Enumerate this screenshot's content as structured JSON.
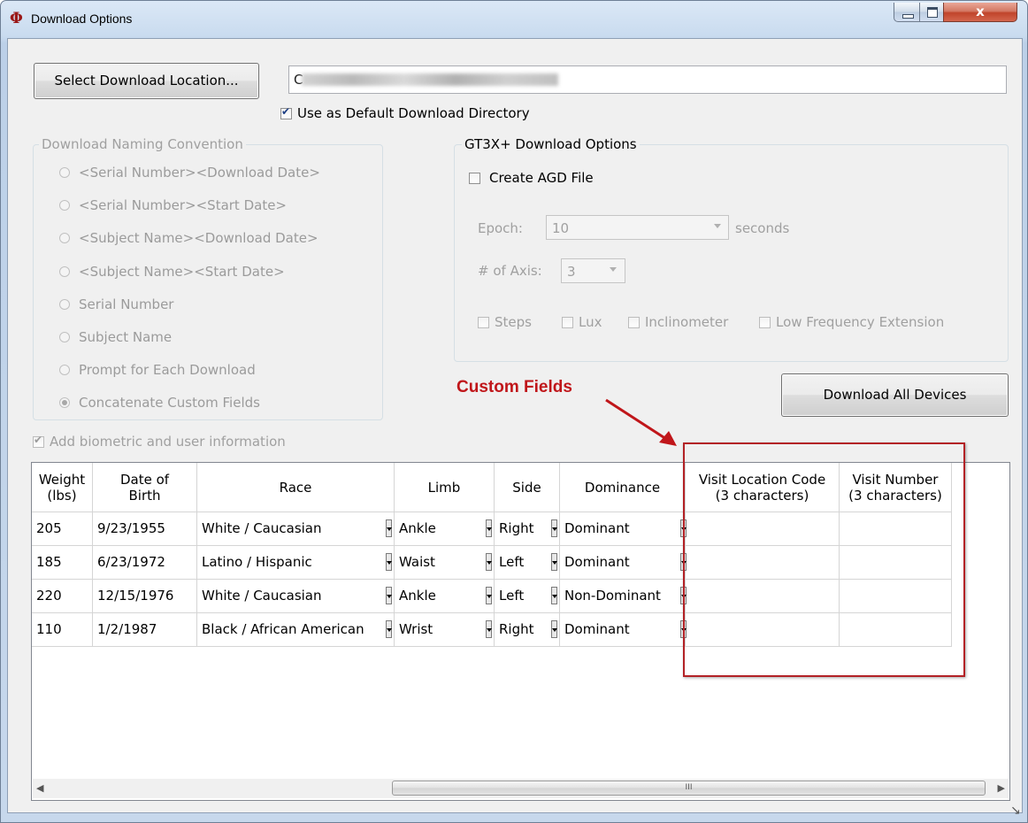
{
  "window": {
    "title": "Download Options",
    "close_glyph": "x"
  },
  "location": {
    "button_label": "Select Download Location...",
    "path_visible_prefix": "C",
    "use_default_label": "Use as Default Download Directory",
    "use_default_checked": true
  },
  "naming": {
    "legend": "Download Naming Convention",
    "options": [
      {
        "label": "<Serial Number><Download Date>",
        "selected": false
      },
      {
        "label": "<Serial Number><Start Date>",
        "selected": false
      },
      {
        "label": "<Subject Name><Download Date>",
        "selected": false
      },
      {
        "label": "<Subject Name><Start Date>",
        "selected": false
      },
      {
        "label": "Serial Number",
        "selected": false
      },
      {
        "label": "Subject Name",
        "selected": false
      },
      {
        "label": "Prompt for Each Download",
        "selected": false
      },
      {
        "label": "Concatenate Custom Fields",
        "selected": true
      }
    ]
  },
  "gt3x": {
    "legend": "GT3X+ Download Options",
    "create_agd_label": "Create AGD File",
    "create_agd_checked": false,
    "epoch_label": "Epoch:",
    "epoch_value": "10",
    "epoch_units": "seconds",
    "axis_label": "# of Axis:",
    "axis_value": "3",
    "options": [
      "Steps",
      "Lux",
      "Inclinometer",
      "Low Frequency Extension"
    ]
  },
  "callout": {
    "text": "Custom Fields",
    "color": "#c0161a"
  },
  "download_all_label": "Download All Devices",
  "biometric": {
    "label": "Add biometric and user information",
    "checked": true
  },
  "grid": {
    "headers": [
      [
        "Weight",
        "(lbs)"
      ],
      [
        "Date of",
        "Birth"
      ],
      [
        "Race"
      ],
      [
        "Limb"
      ],
      [
        "Side"
      ],
      [
        "Dominance"
      ],
      [
        "Visit Location Code",
        "(3 characters)"
      ],
      [
        "Visit Number",
        "(3 characters)"
      ]
    ],
    "rows": [
      [
        "205",
        "9/23/1955",
        "White / Caucasian",
        "Ankle",
        "Right",
        "Dominant",
        "",
        ""
      ],
      [
        "185",
        "6/23/1972",
        "Latino / Hispanic",
        "Waist",
        "Left",
        "Dominant",
        "",
        ""
      ],
      [
        "220",
        "12/15/1976",
        "White / Caucasian",
        "Ankle",
        "Left",
        "Non-Dominant",
        "",
        ""
      ],
      [
        "110",
        "1/2/1987",
        "Black / African American",
        "Wrist",
        "Right",
        "Dominant",
        "",
        ""
      ]
    ],
    "scroll_thumb_glyph": "III"
  },
  "colors": {
    "accent_red": "#b32226",
    "titlebar": "#c9dbef"
  }
}
